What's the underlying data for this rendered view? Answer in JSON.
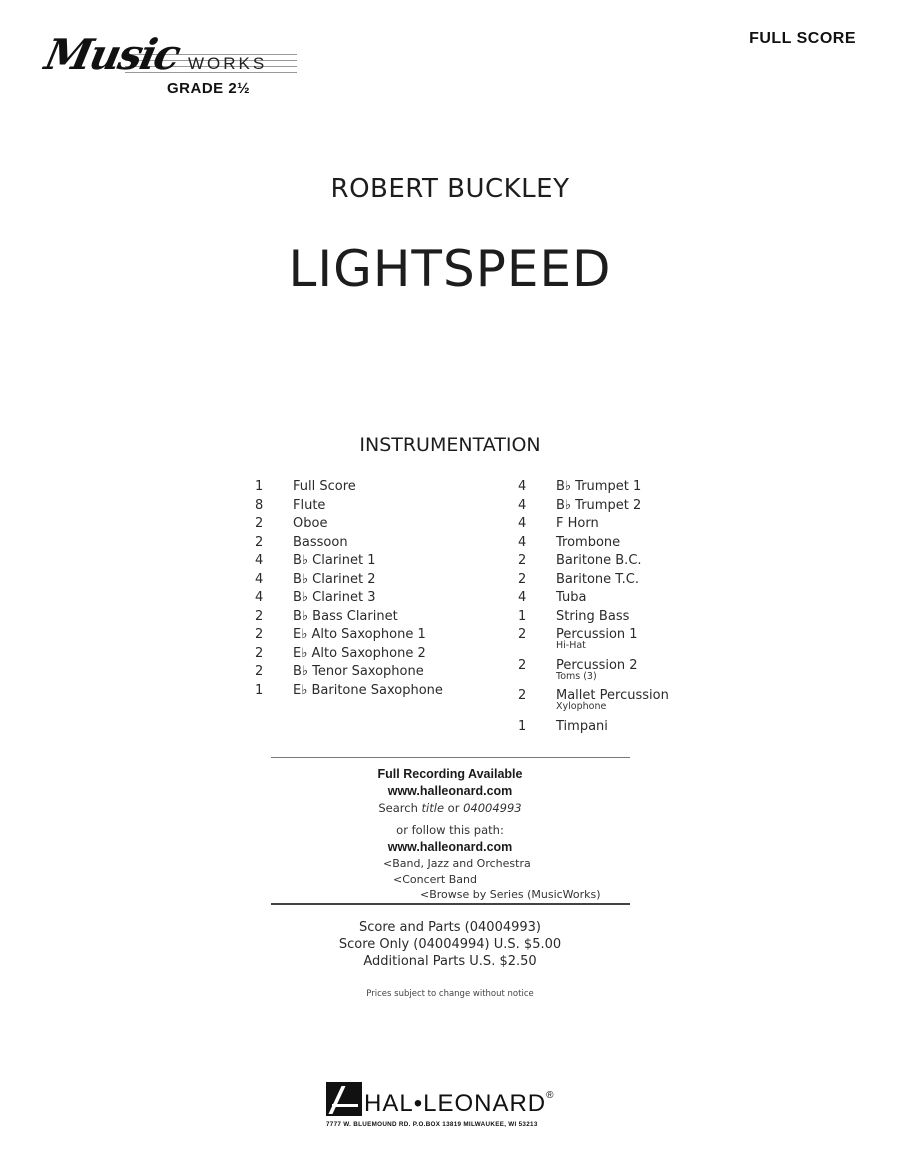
{
  "header": {
    "series_logo_script": "Music",
    "series_logo_works": "WORKS",
    "grade": "GRADE 2½",
    "score_type": "FULL SCORE"
  },
  "composer": "ROBERT BUCKLEY",
  "title": "LIGHTSPEED",
  "instrumentation": {
    "heading": "INSTRUMENTATION",
    "left": [
      {
        "qty": "1",
        "name": "Full Score"
      },
      {
        "qty": "8",
        "name": "Flute"
      },
      {
        "qty": "2",
        "name": "Oboe"
      },
      {
        "qty": "2",
        "name": "Bassoon"
      },
      {
        "qty": "4",
        "name": "B♭ Clarinet 1"
      },
      {
        "qty": "4",
        "name": "B♭ Clarinet 2"
      },
      {
        "qty": "4",
        "name": "B♭ Clarinet 3"
      },
      {
        "qty": "2",
        "name": "B♭ Bass Clarinet"
      },
      {
        "qty": "2",
        "name": "E♭ Alto Saxophone 1"
      },
      {
        "qty": "2",
        "name": "E♭ Alto Saxophone 2"
      },
      {
        "qty": "2",
        "name": "B♭ Tenor Saxophone"
      },
      {
        "qty": "1",
        "name": "E♭ Baritone Saxophone"
      }
    ],
    "right": [
      {
        "qty": "4",
        "name": "B♭ Trumpet 1"
      },
      {
        "qty": "4",
        "name": "B♭ Trumpet 2"
      },
      {
        "qty": "4",
        "name": "F Horn"
      },
      {
        "qty": "4",
        "name": "Trombone"
      },
      {
        "qty": "2",
        "name": "Baritone B.C."
      },
      {
        "qty": "2",
        "name": "Baritone T.C."
      },
      {
        "qty": "4",
        "name": "Tuba"
      },
      {
        "qty": "1",
        "name": "String Bass"
      },
      {
        "qty": "2",
        "name": "Percussion 1",
        "note": "Hi-Hat"
      },
      {
        "qty": "2",
        "name": "Percussion 2",
        "note": "Toms (3)"
      },
      {
        "qty": "2",
        "name": "Mallet Percussion",
        "note": "Xylophone"
      },
      {
        "qty": "1",
        "name": "Timpani"
      }
    ]
  },
  "recording": {
    "heading": "Full Recording Available",
    "url": "www.halleonard.com",
    "search_prefix": "Search ",
    "search_title": "title",
    "search_or": " or ",
    "search_code": "04004993",
    "follow_label": "or follow this path:",
    "path_url": "www.halleonard.com",
    "path": [
      "<Band, Jazz and Orchestra",
      "<Concert Band",
      "<Browse by Series (MusicWorks)"
    ]
  },
  "pricing": {
    "lines": [
      "Score and Parts (04004993)",
      "Score Only (04004994) U.S. $5.00",
      "Additional Parts U.S. $2.50"
    ],
    "note": "Prices subject to change without notice"
  },
  "publisher": {
    "name": "HAL•LEONARD",
    "registered": "®",
    "address": "7777 W. BLUEMOUND RD. P.O.BOX 13819 MILWAUKEE, WI 53213"
  }
}
